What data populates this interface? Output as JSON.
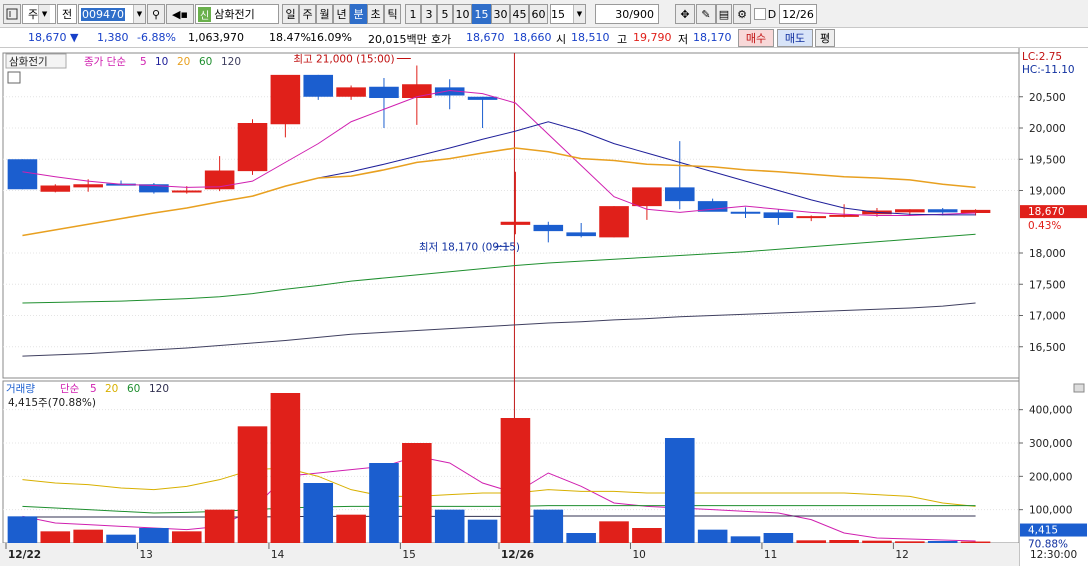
{
  "toolbar": {
    "combo1": "주",
    "combo2": "전",
    "code": "009470",
    "stock_name": "삼화전기",
    "sin_badge": "신",
    "periods": [
      "일",
      "주",
      "월",
      "년",
      "분",
      "초",
      "틱"
    ],
    "active_period": "분",
    "intervals": [
      "1",
      "3",
      "5",
      "10",
      "15",
      "30",
      "45",
      "60"
    ],
    "active_interval": "15",
    "interval_combo": "15",
    "count": "30/900",
    "d_label": "D",
    "date": "12/26"
  },
  "quote": {
    "price": "18,670",
    "arrow": "▼",
    "change": "1,380",
    "change_pct": "-6.88%",
    "volume": "1,063,970",
    "turnover_pct": "18.47%",
    "pct2": "16.09%",
    "amount": "20,015백만",
    "hoga_label": "호가",
    "ask": "18,670",
    "bid": "18,660",
    "open_label": "시",
    "open": "18,510",
    "high_label": "고",
    "high": "19,790",
    "low_label": "저",
    "low": "18,170",
    "buy_btn": "매수",
    "sell_btn": "매도",
    "extra_btn": "평"
  },
  "price_pane": {
    "legend_name": "삼화전기",
    "legend_ma_label": "종가 단순",
    "ma_periods": [
      "5",
      "10",
      "20",
      "60",
      "120"
    ],
    "ma_colors": [
      "#d020b0",
      "#20209a",
      "#e8a020",
      "#1f8f2f",
      "#404060"
    ],
    "high_annot": "최고 21,000 (15:00)",
    "low_annot": "최저 18,170 (09:15)",
    "lc": "LC:2.75",
    "hc": "HC:-11.10",
    "last": "18,670",
    "last_pct": "0.43%",
    "yticks": [
      "20,500",
      "20,000",
      "19,500",
      "19,000",
      "18,000",
      "17,500",
      "17,000",
      "16,500"
    ]
  },
  "volume_pane": {
    "legend_name": "거래량",
    "legend_ma_label": "단순",
    "ma_periods": [
      "5",
      "20",
      "60",
      "120"
    ],
    "current": "4,415주(70.88%)",
    "last": "4,415",
    "last_pct": "70.88%",
    "yticks": [
      "400,000",
      "300,000",
      "200,000",
      "100,000"
    ]
  },
  "x_axis": {
    "labels": [
      "12/22",
      "13",
      "14",
      "15",
      "12/26",
      "10",
      "11",
      "12"
    ],
    "time": "12:30:00"
  },
  "chart_data": {
    "type": "candlestick",
    "candles": [
      {
        "o": 19500,
        "h": 19500,
        "l": 19020,
        "c": 19020,
        "v": 80000
      },
      {
        "o": 18980,
        "h": 19100,
        "l": 18970,
        "c": 19080,
        "v": 35000
      },
      {
        "o": 19050,
        "h": 19180,
        "l": 18980,
        "c": 19100,
        "v": 40000
      },
      {
        "o": 19110,
        "h": 19160,
        "l": 19080,
        "c": 19090,
        "v": 25000
      },
      {
        "o": 19100,
        "h": 19120,
        "l": 18950,
        "c": 18970,
        "v": 45000
      },
      {
        "o": 18980,
        "h": 19070,
        "l": 18950,
        "c": 19000,
        "v": 35000
      },
      {
        "o": 19020,
        "h": 19550,
        "l": 18990,
        "c": 19320,
        "v": 100000
      },
      {
        "o": 19310,
        "h": 20140,
        "l": 19250,
        "c": 20080,
        "v": 350000
      },
      {
        "o": 20060,
        "h": 20800,
        "l": 19850,
        "c": 20850,
        "v": 450000
      },
      {
        "o": 20850,
        "h": 20850,
        "l": 20450,
        "c": 20500,
        "v": 180000
      },
      {
        "o": 20500,
        "h": 20680,
        "l": 20450,
        "c": 20650,
        "v": 85000
      },
      {
        "o": 20660,
        "h": 20800,
        "l": 20000,
        "c": 20480,
        "v": 240000
      },
      {
        "o": 20480,
        "h": 21000,
        "l": 20050,
        "c": 20700,
        "v": 300000
      },
      {
        "o": 20650,
        "h": 20780,
        "l": 20300,
        "c": 20520,
        "v": 100000
      },
      {
        "o": 20500,
        "h": 20500,
        "l": 20000,
        "c": 20450,
        "v": 70000
      },
      {
        "o": 18450,
        "h": 19300,
        "l": 18300,
        "c": 18500,
        "v": 375000
      },
      {
        "o": 18450,
        "h": 18500,
        "l": 18170,
        "c": 18350,
        "v": 100000
      },
      {
        "o": 18330,
        "h": 18480,
        "l": 18250,
        "c": 18270,
        "v": 30000
      },
      {
        "o": 18250,
        "h": 18750,
        "l": 18250,
        "c": 18750,
        "v": 65000
      },
      {
        "o": 18750,
        "h": 19040,
        "l": 18530,
        "c": 19050,
        "v": 45000
      },
      {
        "o": 19050,
        "h": 19790,
        "l": 18700,
        "c": 18830,
        "v": 315000
      },
      {
        "o": 18830,
        "h": 18870,
        "l": 18670,
        "c": 18660,
        "v": 40000
      },
      {
        "o": 18660,
        "h": 18730,
        "l": 18560,
        "c": 18650,
        "v": 20000
      },
      {
        "o": 18650,
        "h": 18700,
        "l": 18450,
        "c": 18560,
        "v": 30000
      },
      {
        "o": 18560,
        "h": 18600,
        "l": 18510,
        "c": 18590,
        "v": 8000
      },
      {
        "o": 18590,
        "h": 18780,
        "l": 18570,
        "c": 18610,
        "v": 9000
      },
      {
        "o": 18620,
        "h": 18720,
        "l": 18580,
        "c": 18680,
        "v": 7000
      },
      {
        "o": 18650,
        "h": 18700,
        "l": 18600,
        "c": 18700,
        "v": 5000
      },
      {
        "o": 18700,
        "h": 18720,
        "l": 18600,
        "c": 18650,
        "v": 6000
      },
      {
        "o": 18640,
        "h": 18700,
        "l": 18600,
        "c": 18690,
        "v": 4415
      }
    ],
    "ma": {
      "5": [
        19300,
        19220,
        19150,
        19100,
        19080,
        19050,
        19060,
        19150,
        19450,
        19750,
        20100,
        20300,
        20500,
        20600,
        20550,
        20400,
        19900,
        19400,
        18900,
        18700,
        18650,
        18700,
        18750,
        18700,
        18650,
        18620,
        18600,
        18600,
        18620,
        18640
      ],
      "10": [
        null,
        null,
        null,
        null,
        null,
        null,
        null,
        null,
        null,
        19200,
        19300,
        19420,
        19550,
        19680,
        19820,
        19950,
        20100,
        19950,
        19750,
        19600,
        19450,
        19300,
        19150,
        19000,
        18850,
        18720,
        18650,
        18620,
        18610,
        18610
      ],
      "20": [
        18280,
        18370,
        18460,
        18550,
        18640,
        18720,
        18820,
        18910,
        19070,
        19200,
        19230,
        19330,
        19450,
        19510,
        19600,
        19680,
        19620,
        19510,
        19480,
        19420,
        19400,
        19380,
        19330,
        19300,
        19260,
        19220,
        19200,
        19170,
        19100,
        19050
      ],
      "60": [
        17200,
        17210,
        17220,
        17230,
        17250,
        17270,
        17300,
        17350,
        17420,
        17480,
        17550,
        17600,
        17650,
        17700,
        17750,
        17800,
        17840,
        17870,
        17900,
        17930,
        17960,
        17990,
        18020,
        18060,
        18100,
        18140,
        18180,
        18220,
        18260,
        18300
      ],
      "120": [
        16350,
        16370,
        16390,
        16420,
        16450,
        16480,
        16520,
        16560,
        16600,
        16650,
        16700,
        16730,
        16760,
        16790,
        16820,
        16850,
        16880,
        16900,
        16930,
        16950,
        16980,
        17000,
        17020,
        17040,
        17060,
        17080,
        17100,
        17120,
        17150,
        17200
      ]
    },
    "vol_ma": {
      "5": [
        80000,
        60000,
        55000,
        50000,
        45000,
        40000,
        50000,
        100000,
        200000,
        210000,
        220000,
        230000,
        260000,
        240000,
        180000,
        150000,
        210000,
        170000,
        120000,
        110000,
        105000,
        100000,
        95000,
        90000,
        70000,
        30000,
        15000,
        12000,
        9000,
        6000
      ],
      "20": [
        190000,
        180000,
        175000,
        165000,
        160000,
        170000,
        190000,
        220000,
        225000,
        200000,
        160000,
        140000,
        140000,
        145000,
        150000,
        150000,
        160000,
        155000,
        155000,
        150000,
        150000,
        150000,
        150000,
        150000,
        150000,
        150000,
        145000,
        140000,
        120000,
        110000
      ],
      "60": [
        110000,
        105000,
        100000,
        95000,
        90000,
        92000,
        95000,
        100000,
        105000,
        108000,
        110000,
        110000,
        110000,
        110000,
        110000,
        110000,
        112000,
        112000,
        112000,
        112000,
        112000,
        112000,
        112000,
        112000,
        112000,
        112000,
        112000,
        112000,
        112000,
        112000
      ],
      "120": [
        78000,
        78000,
        78000,
        78000,
        78000,
        78000,
        78000,
        78000,
        79000,
        80000,
        80000,
        80000,
        80000,
        80000,
        80000,
        80000,
        81000,
        81000,
        81000,
        81000,
        81000,
        81000,
        81000,
        81000,
        81000,
        81000,
        81000,
        81000,
        81000,
        81000
      ]
    },
    "y_price": [
      16000,
      21200
    ],
    "y_volume": [
      0,
      450000
    ],
    "colors": {
      "up": "#e0201a",
      "down": "#1b5ecf"
    }
  }
}
